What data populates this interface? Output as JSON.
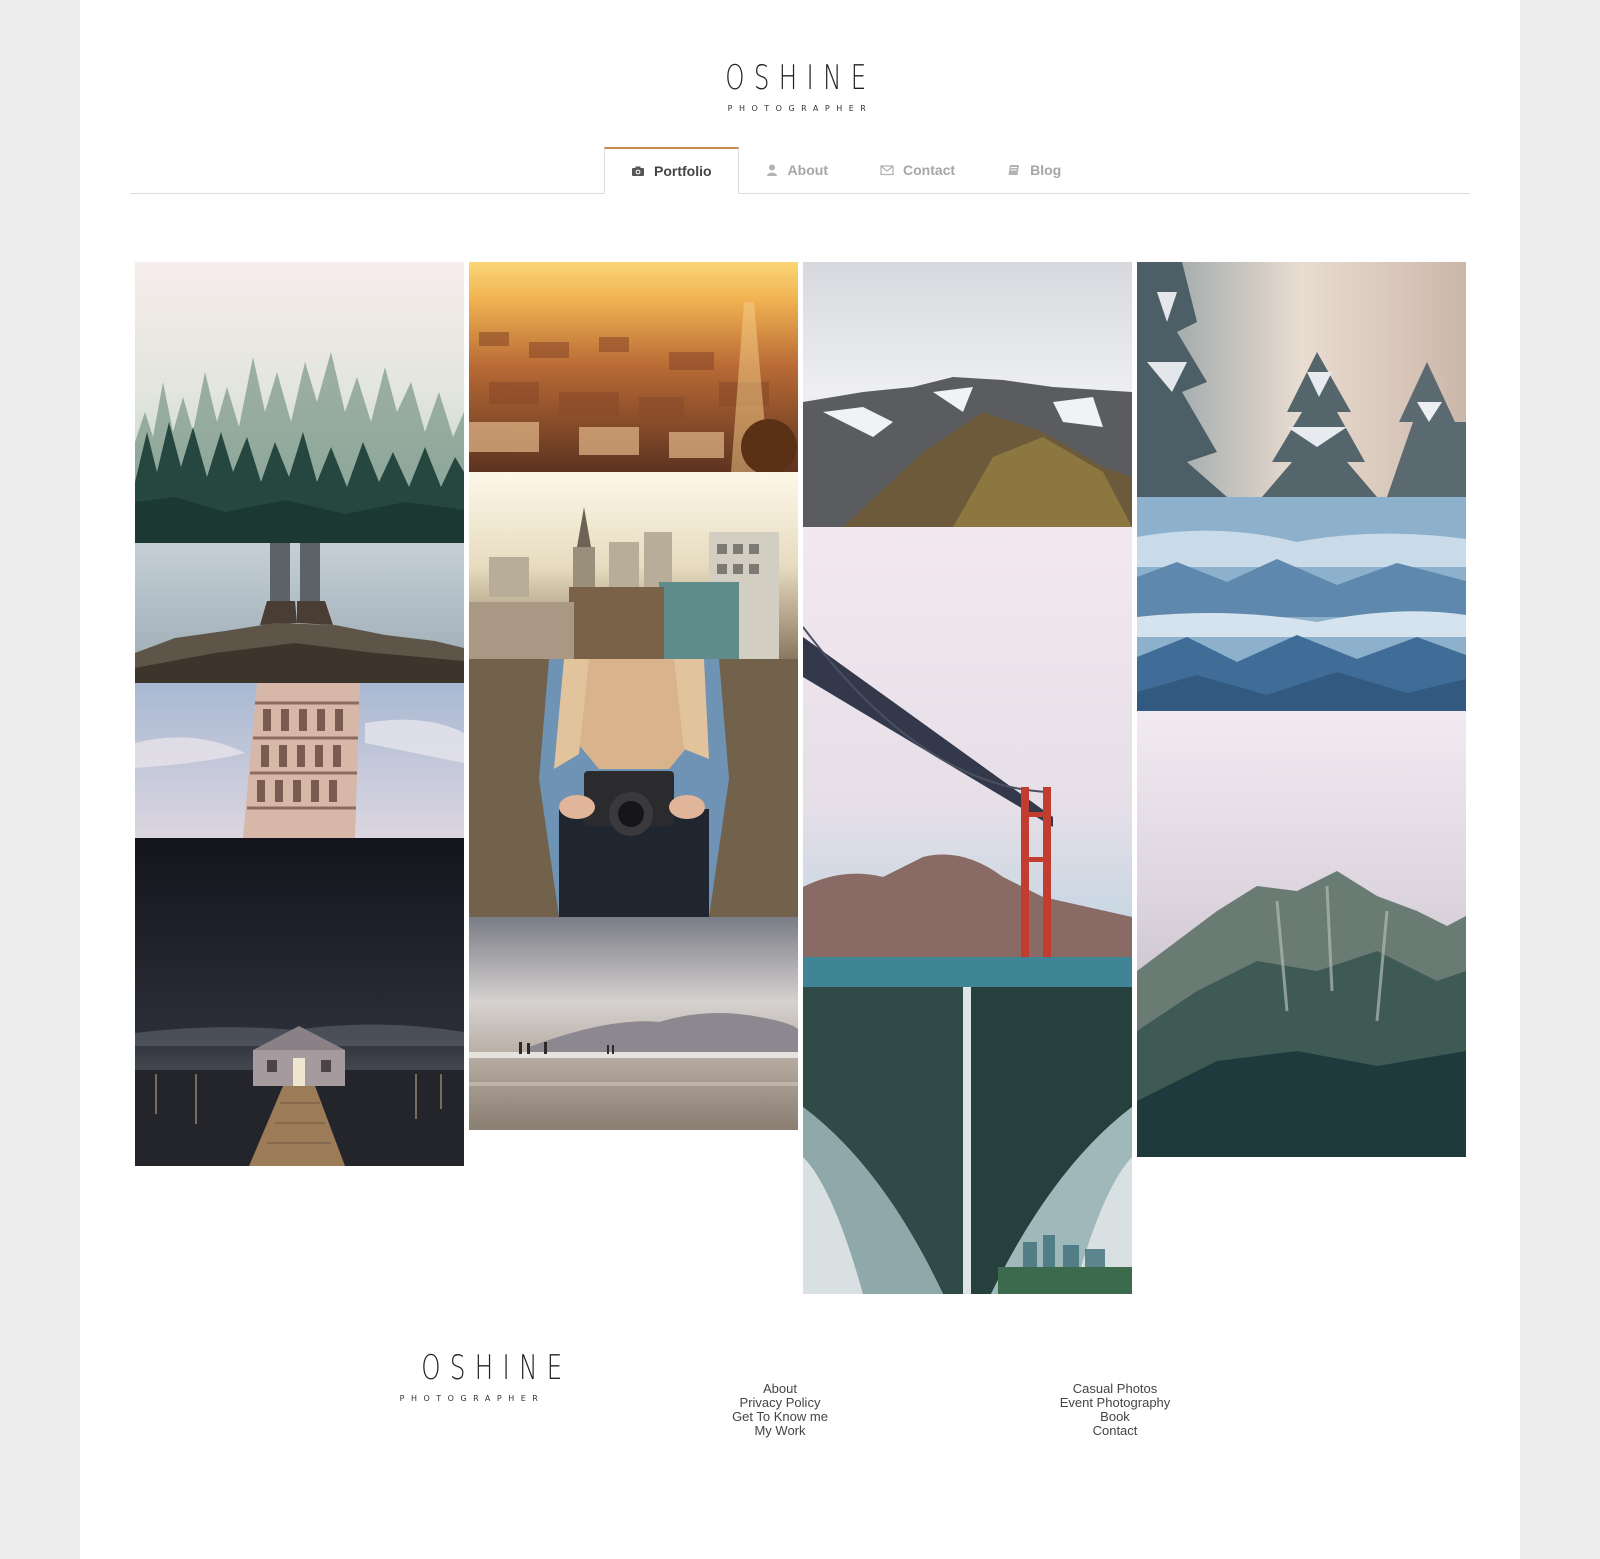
{
  "brand": {
    "name": "OSHINE",
    "tagline": "PHOTOGRAPHER"
  },
  "nav": {
    "tabs": [
      {
        "label": "Portfolio",
        "icon": "camera-icon",
        "active": true
      },
      {
        "label": "About",
        "icon": "user-icon",
        "active": false
      },
      {
        "label": "Contact",
        "icon": "envelope-icon",
        "active": false
      },
      {
        "label": "Blog",
        "icon": "book-icon",
        "active": false
      }
    ],
    "accent_color": "#c88a4e"
  },
  "gallery": {
    "photos": [
      "misty-pine-forest",
      "hiking-boots-on-rock",
      "leaning-tower-of-pisa",
      "boathouse-at-night",
      "city-sunset-aerial",
      "town-rooftops-church",
      "woman-holding-camera",
      "beach-with-people",
      "snowy-mountain-peak",
      "golden-gate-bridge",
      "under-bridge-view",
      "snowy-pine-trees",
      "blue-mountain-ranges",
      "foggy-mountain-cliff"
    ]
  },
  "footer": {
    "links_col1": [
      "About",
      "Privacy Policy",
      "Get To Know me",
      "My Work"
    ],
    "links_col2": [
      "Casual Photos",
      "Event Photography",
      "Book",
      "Contact"
    ]
  }
}
